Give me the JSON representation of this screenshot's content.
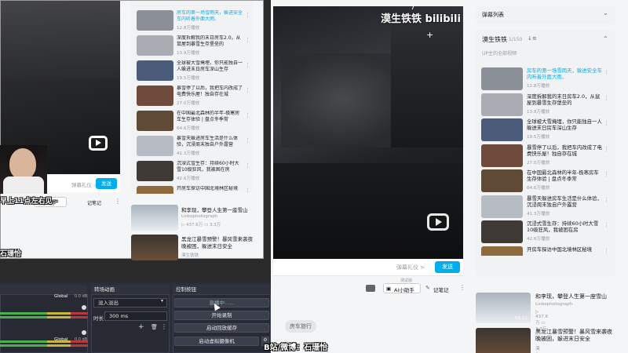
{
  "bg_player": {
    "logo": "bilibili",
    "uploader_mark": "漠生铁铁",
    "ep": "7",
    "danmaku_placeholder": "弹幕礼仪 >",
    "send_label": "发送",
    "ai_label": "AI小助手",
    "ai_badge": "测试版",
    "notes_label": "记笔记",
    "tag": "房车旅行"
  },
  "sidebar": {
    "danmaku_list_title": "弹幕列表",
    "playlist_title": "漠生铁铁",
    "playlist_count": "1/150",
    "playlist_sub": "UP主的全部视频",
    "items": [
      {
        "title": "房车的第一场雪雨天，躲进安全车内听着外面大雨、",
        "views": "12.8万播放",
        "active": true,
        "thumb": "#8b8f97"
      },
      {
        "title": "深度拆解我的末日房车2.0，从鼠屋到暴雪生存堡垒的",
        "views": "13.9万播放",
        "active": false,
        "thumb": "#a9acb3"
      },
      {
        "title": "全球被大雪掩埋，你只能独自一人躲进末日房车深山生存",
        "views": "19.5万播放",
        "active": false,
        "thumb": "#4a5c7a"
      },
      {
        "title": "暴雪停了以后，我把车内改成了电费快乐屋！独自存在城",
        "views": "27.0万播放",
        "active": false,
        "thumb": "#6f4b3e"
      },
      {
        "title": "在中国最北森林的半年-极寒房车生存体验 | 盘点冬季常",
        "views": "64.6万播放",
        "active": false,
        "thumb": "#5e4a35"
      },
      {
        "title": "暴雪天躲进房车生活是什么体验，沉浸周末独自户外露营",
        "views": "41.3万播放",
        "active": false,
        "thumb": "#b7bcc4"
      },
      {
        "title": "沉浸式雪生存：持续60小时大雪10级狂风，我被困在房",
        "views": "42.6万播放",
        "active": false,
        "thumb": "#3f3a35"
      },
      {
        "title": "开房车探访中国北境林区秘境",
        "views": "",
        "active": false,
        "thumb": "#8f6a3c"
      }
    ],
    "recommend": [
      {
        "title": "和李现，攀登人生第一座雪山",
        "author": "Linkophotograph",
        "plays": "437.6万",
        "comments": "3.3万",
        "duration": "55:12"
      },
      {
        "title": "黑龙江暴雪预警！暴风雪来袭夜晚被困，躲进末日安全",
        "author": "漠生铁铁",
        "plays": "",
        "comments": "",
        "duration": ""
      }
    ]
  },
  "mini_player": {
    "danmaku_placeholder": "弹幕礼仪 >",
    "send_label": "发送",
    "ai_label": "AI小助手",
    "notes_label": "记笔记"
  },
  "obs": {
    "transitions_title": "转场动画",
    "transition_value": "淡入淡出",
    "duration_label": "时长",
    "duration_value": "300 ms",
    "controls_title": "控制按钮",
    "streaming_label": "直播中......",
    "record_label": "开始录制",
    "replay_label": "启动回放缓存",
    "vcam_label": "启动虚拟摄像机",
    "meter_label": "Global",
    "meter_db": "0.0 dB"
  },
  "subtitles": {
    "left": "早上11点左右见~",
    "name": "石珊怡",
    "credit": "B站/微博：石珊怡"
  }
}
